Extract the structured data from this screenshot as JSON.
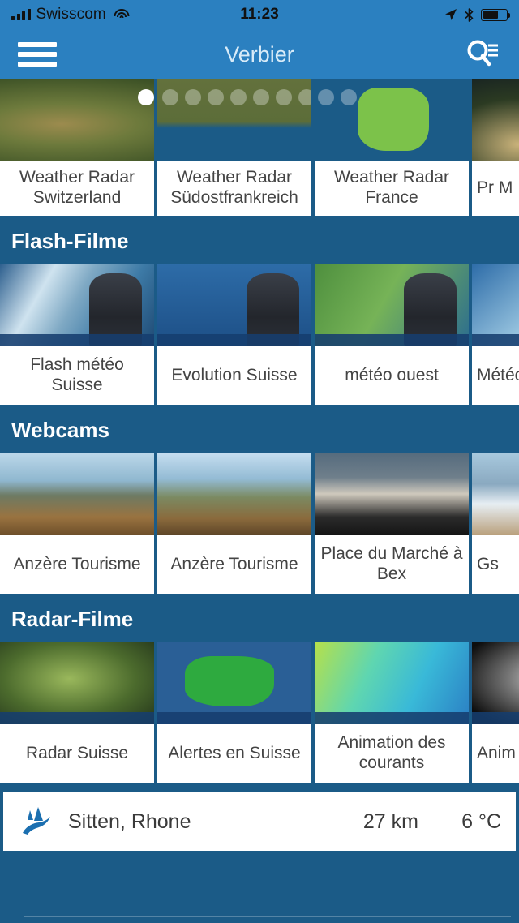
{
  "status_bar": {
    "carrier": "Swisscom",
    "time": "11:23",
    "icons": [
      "signal-bars-icon",
      "wifi-icon",
      "location-arrow-icon",
      "bluetooth-icon",
      "battery-icon"
    ],
    "battery_percent": 66
  },
  "nav": {
    "title": "Verbier",
    "menu_icon": "hamburger-menu-icon",
    "search_icon": "search-list-icon"
  },
  "colors": {
    "nav_blue": "#2b80c0",
    "background_blue": "#1b5b87",
    "card_white": "#ffffff",
    "label_text": "#444444",
    "title_text": "#ffffff",
    "logo_blue": "#1b6fb0"
  },
  "pager": {
    "total_dots": 10,
    "active_index": 0
  },
  "sections": [
    {
      "id": "weather-radar",
      "title": "",
      "cards": [
        {
          "label": "Weather Radar Switzerland",
          "thumb": "t-swiss"
        },
        {
          "label": "Weather Radar Südostfrankreich",
          "thumb": "t-seference"
        },
        {
          "label": "Weather Radar France",
          "thumb": "t-france"
        },
        {
          "label": "Pr M",
          "thumb": "t-dark"
        }
      ]
    },
    {
      "id": "flash-filme",
      "title": "Flash-Filme",
      "cards": [
        {
          "label": "Flash météo Suisse",
          "thumb": "t-flash1"
        },
        {
          "label": "Evolution Suisse",
          "thumb": "t-flash2"
        },
        {
          "label": "météo ouest",
          "thumb": "t-flash3"
        },
        {
          "label": "Météo",
          "thumb": "t-flash4"
        }
      ]
    },
    {
      "id": "webcams",
      "title": "Webcams",
      "cards": [
        {
          "label": "Anzère Tourisme",
          "thumb": "t-cam1"
        },
        {
          "label": "Anzère Tourisme",
          "thumb": "t-cam2"
        },
        {
          "label": "Place du Marché à Bex",
          "thumb": "t-cam3"
        },
        {
          "label": "Gs",
          "thumb": "t-cam4"
        }
      ]
    },
    {
      "id": "radar-filme",
      "title": "Radar-Filme",
      "cards": [
        {
          "label": "Radar Suisse",
          "thumb": "t-rad1"
        },
        {
          "label": "Alertes en Suisse",
          "thumb": "t-rad2"
        },
        {
          "label": "Animation des courants",
          "thumb": "t-rad3"
        },
        {
          "label": "Anim",
          "thumb": "t-rad4"
        }
      ]
    }
  ],
  "place_row": {
    "logo_icon": "mountain-valley-logo-icon",
    "name": "Sitten, Rhone",
    "distance": "27 km",
    "temperature": "6 °C"
  }
}
